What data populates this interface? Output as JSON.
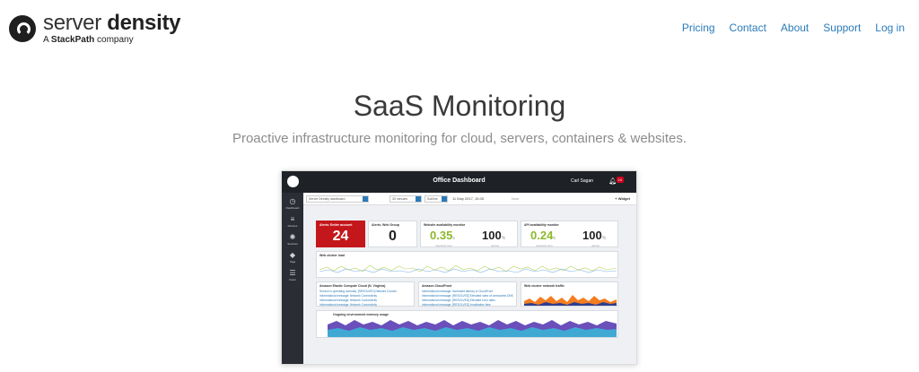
{
  "brand": {
    "name_light": "server",
    "name_bold": "density",
    "sub_prefix": "A ",
    "sub_bold": "StackPath",
    "sub_suffix": " company"
  },
  "nav": [
    "Pricing",
    "Contact",
    "About",
    "Support",
    "Log in"
  ],
  "hero": {
    "title": "SaaS Monitoring",
    "subtitle": "Proactive infrastructure monitoring for cloud, servers, containers & websites."
  },
  "dashboard": {
    "title": "Office Dashboard",
    "user": "Carl Sagan",
    "notif_count": "24",
    "sidebar": [
      {
        "icon": "dashboard-icon",
        "glyph": "◷",
        "label": "Dashboard"
      },
      {
        "icon": "devices-icon",
        "glyph": "≡",
        "label": "Devices"
      },
      {
        "icon": "services-icon",
        "glyph": "✺",
        "label": "Services"
      },
      {
        "icon": "tags-icon",
        "glyph": "◆",
        "label": "Tags"
      },
      {
        "icon": "users-icon",
        "glyph": "☰",
        "label": "Users"
      }
    ],
    "toolbar": {
      "dashboard_select": "Server Density dashboard",
      "range_select": "30 minutes",
      "mode_select": "Subline",
      "date": "11 May 2017, 15:05",
      "now": "Now",
      "widget_button": "+ Widget"
    },
    "cards": {
      "alerts_open_title": "Alerts: Entire account",
      "alerts_open_value": "24",
      "alerts_web_title": "Alerts: Web Group",
      "alerts_web_value": "0",
      "website_title": "Website availability monitor",
      "website_resp": "0.35",
      "website_resp_unit": "s",
      "website_resp_label": "response time",
      "website_uptime": "100",
      "website_uptime_unit": "%",
      "website_uptime_label": "uptime",
      "api_title": "API availability monitor",
      "api_resp": "0.24",
      "api_resp_unit": "s",
      "api_resp_label": "response time",
      "api_uptime": "100",
      "api_uptime_unit": "%",
      "api_uptime_label": "uptime",
      "web_load_title": "Web cluster load",
      "ec2_title": "Amazon Elastic Compute Cloud (N. Virginia)",
      "ec2_items": [
        "Service is operating normally: [RESOLVED] Network Connect...",
        "Informational message: Network Connectivity",
        "Informational message: Network Connectivity",
        "Informational message: Network Connectivity"
      ],
      "cf_title": "Amazon CloudFront",
      "cf_items": [
        "Informational message: Increased latency in CloudFront",
        "Informational message: [RESOLVED] Elevated rates of unresolved DNS...",
        "Informational message: [RESOLVED] Elevated error rates",
        "Informational message: [RESOLVED] Invalidation time"
      ],
      "traffic_title": "Web cluster network traffic",
      "memory_title": "Ongoing environment memory usage"
    }
  }
}
